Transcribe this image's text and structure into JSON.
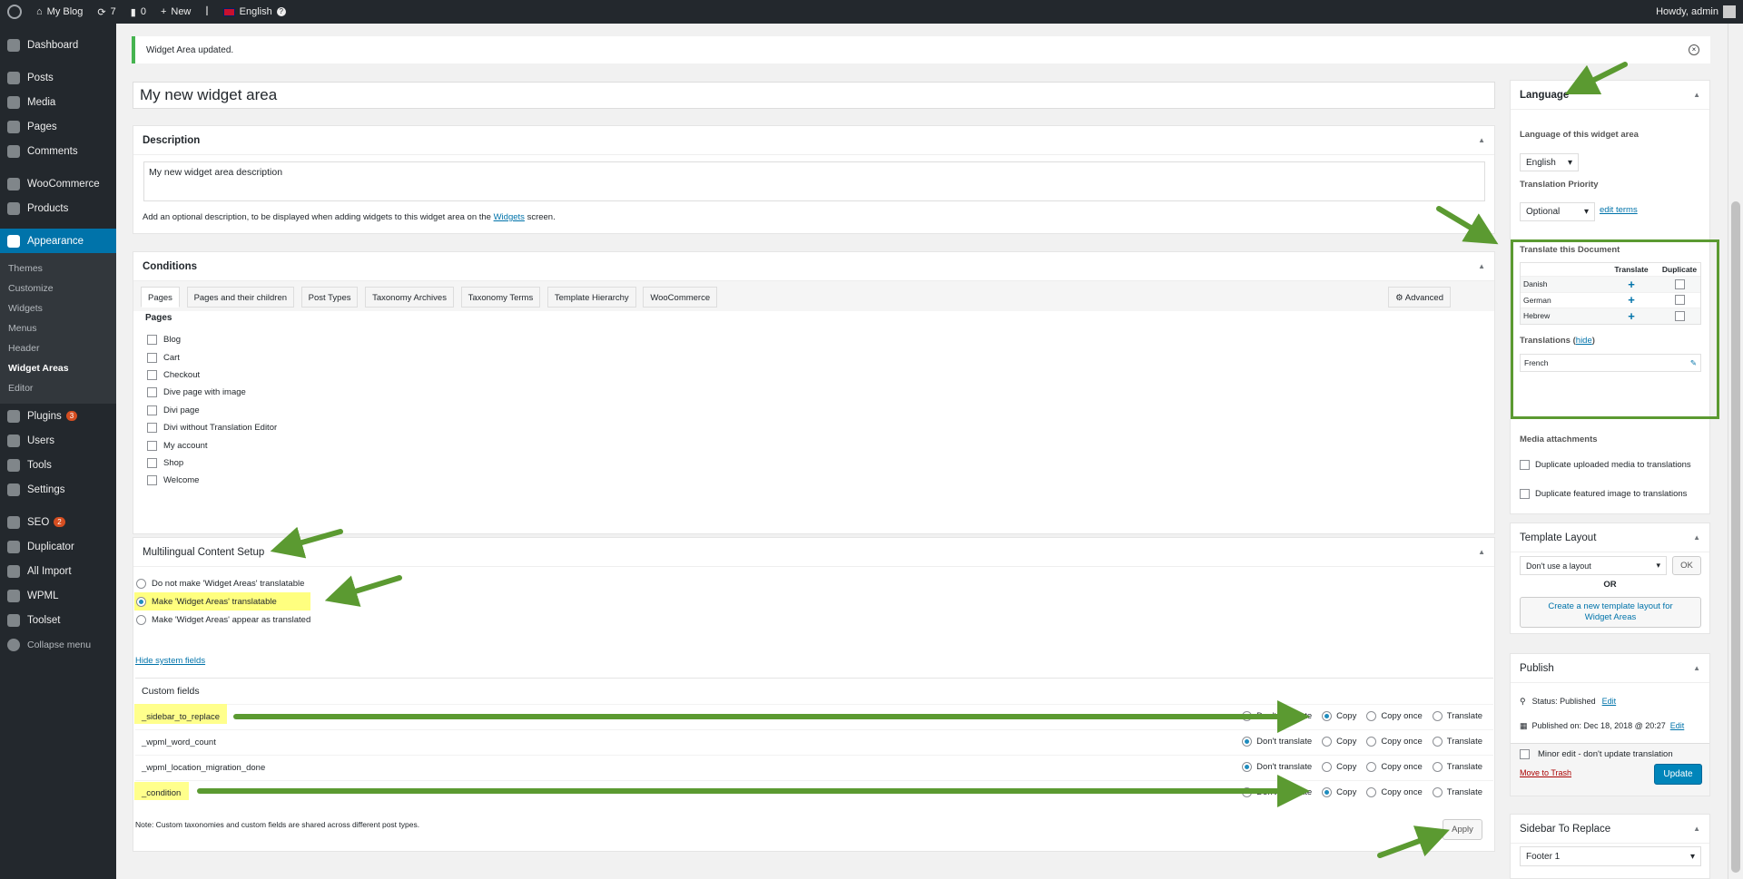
{
  "adminbar": {
    "site": "My Blog",
    "updates": "7",
    "comments": "0",
    "new": "New",
    "language": "English",
    "howdy": "Howdy, admin"
  },
  "sidebar": {
    "items": [
      {
        "label": "Dashboard"
      },
      {
        "label": "Posts"
      },
      {
        "label": "Media"
      },
      {
        "label": "Pages"
      },
      {
        "label": "Comments"
      },
      {
        "label": "WooCommerce"
      },
      {
        "label": "Products"
      },
      {
        "label": "Appearance"
      },
      {
        "label": "Plugins",
        "badge": "3"
      },
      {
        "label": "Users"
      },
      {
        "label": "Tools"
      },
      {
        "label": "Settings"
      },
      {
        "label": "SEO",
        "badge": "2"
      },
      {
        "label": "Duplicator"
      },
      {
        "label": "All Import"
      },
      {
        "label": "WPML"
      },
      {
        "label": "Toolset"
      },
      {
        "label": "Collapse menu"
      }
    ],
    "submenu": [
      "Themes",
      "Customize",
      "Widgets",
      "Menus",
      "Header",
      "Widget Areas",
      "Editor"
    ]
  },
  "notice": {
    "text": "Widget Area updated.",
    "close": "×"
  },
  "title_value": "My new widget area",
  "description": {
    "heading": "Description",
    "value": "My new widget area description",
    "help_prefix": "Add an optional description, to be displayed when adding widgets to this widget area on the",
    "help_link": "Widgets",
    "help_suffix": "screen."
  },
  "conditions": {
    "heading": "Conditions",
    "tabs": [
      "Pages",
      "Pages and their children",
      "Post Types",
      "Taxonomy Archives",
      "Taxonomy Terms",
      "Template Hierarchy",
      "WooCommerce"
    ],
    "advanced": "Advanced",
    "pages_heading": "Pages",
    "pages": [
      "Blog",
      "Cart",
      "Checkout",
      "Dive page with image",
      "Divi page",
      "Divi without Translation Editor",
      "My account",
      "Shop",
      "Welcome"
    ]
  },
  "mcs": {
    "heading": "Multilingual Content Setup",
    "options": [
      "Do not make 'Widget Areas' translatable",
      "Make 'Widget Areas' translatable",
      "Make 'Widget Areas' appear as translated"
    ],
    "selected": 1,
    "hide_link": "Hide system fields",
    "custom_fields_heading": "Custom fields",
    "fields": [
      {
        "name": "_sidebar_to_replace",
        "selected": "Copy"
      },
      {
        "name": "_wpml_word_count",
        "selected": "Don't translate"
      },
      {
        "name": "_wpml_location_migration_done",
        "selected": "Don't translate"
      },
      {
        "name": "_condition",
        "selected": "Copy"
      }
    ],
    "choices": [
      "Don't translate",
      "Copy",
      "Copy once",
      "Translate"
    ],
    "note": "Note: Custom taxonomies and custom fields are shared across different post types.",
    "apply": "Apply"
  },
  "language_box": {
    "heading": "Language",
    "lang_label": "Language of this widget area",
    "lang_value": "English",
    "priority_label": "Translation Priority",
    "priority_value": "Optional",
    "edit_terms": "edit terms",
    "translate_heading": "Translate this Document",
    "col_translate": "Translate",
    "col_duplicate": "Duplicate",
    "languages": [
      "Danish",
      "German",
      "Hebrew"
    ],
    "translations_label": "Translations",
    "hide": "hide",
    "translations": [
      "French"
    ],
    "media_heading": "Media attachments",
    "media_opt1": "Duplicate uploaded media to translations",
    "media_opt2": "Duplicate featured image to translations"
  },
  "template_layout": {
    "heading": "Template Layout",
    "select": "Don't use a layout",
    "ok": "OK",
    "or": "OR",
    "create": "Create a new template layout for Widget Areas"
  },
  "publish": {
    "heading": "Publish",
    "status": "Status: Published",
    "status_edit": "Edit",
    "published_on": "Published on: Dec 18, 2018 @ 20:27",
    "date_edit": "Edit",
    "minor_edit": "Minor edit - don't update translation",
    "trash": "Move to Trash",
    "update": "Update"
  },
  "sidebar_replace": {
    "heading": "Sidebar To Replace",
    "value": "Footer 1"
  },
  "colors": {
    "accent": "#0073aa",
    "arrow": "#5b9a31",
    "highlight": "#ffff7f",
    "adminbar": "#23282d"
  }
}
